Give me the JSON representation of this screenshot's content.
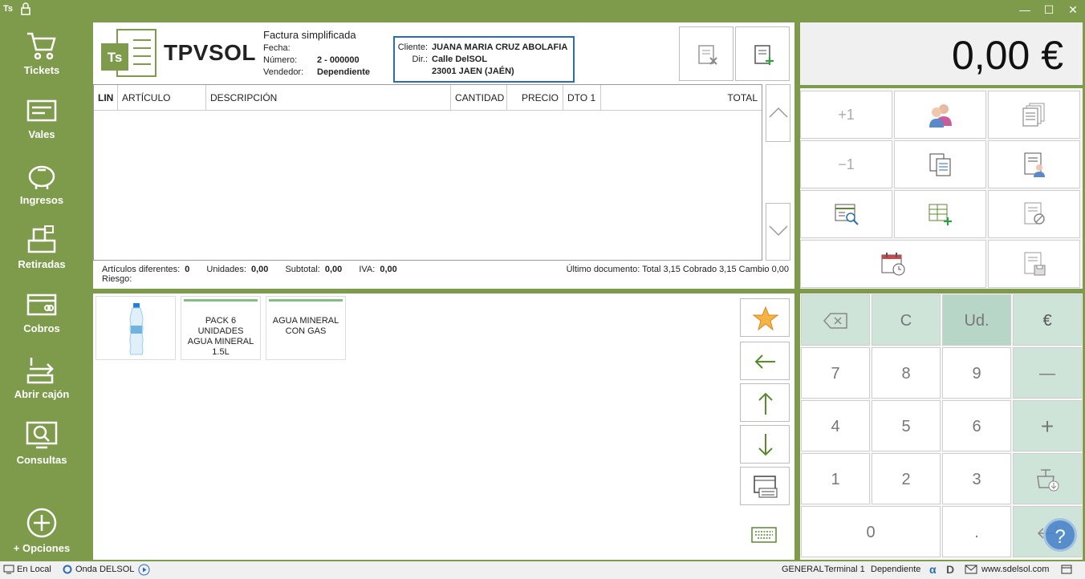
{
  "titlebar": {
    "app_short": "Ts",
    "minimize": "—",
    "maximize": "☐",
    "close": "✕"
  },
  "sidebar": {
    "items": [
      {
        "label": "Tickets"
      },
      {
        "label": "Vales"
      },
      {
        "label": "Ingresos"
      },
      {
        "label": "Retiradas"
      },
      {
        "label": "Cobros"
      },
      {
        "label": "Abrir cajón"
      },
      {
        "label": "Consultas"
      }
    ],
    "options_label": "+ Opciones"
  },
  "header": {
    "logo_mark": "Ts",
    "brand": "TPVSOL",
    "doc_type": "Factura simplificada",
    "fields": [
      {
        "key": "Fecha:",
        "value": ""
      },
      {
        "key": "Número:",
        "value": "2 - 000000"
      },
      {
        "key": "Vendedor:",
        "value": "Dependiente"
      }
    ],
    "client": {
      "client_label": "Cliente:",
      "client_name": "JUANA MARIA CRUZ ABOLAFIA",
      "dir_label": "Dir.:",
      "address1": "Calle DelSOL",
      "address2": "23001 JAEN (JAÉN)"
    }
  },
  "grid": {
    "columns": [
      "LIN",
      "ARTÍCULO",
      "DESCRIPCIÓN",
      "CANTIDAD",
      "PRECIO",
      "DTO 1",
      "TOTAL"
    ]
  },
  "summary": {
    "articulos_label": "Artículos diferentes:",
    "articulos": "0",
    "unidades_label": "Unidades:",
    "unidades": "0,00",
    "subtotal_label": "Subtotal:",
    "subtotal": "0,00",
    "iva_label": "IVA:",
    "iva": "0,00",
    "riesgo_label": "Riesgo:",
    "last_doc": "Último documento: Total 3,15 Cobrado 3,15 Cambio 0,00"
  },
  "products": [
    {
      "name": ""
    },
    {
      "name": "PACK 6 UNIDADES AGUA MINERAL 1.5L"
    },
    {
      "name": "AGUA MINERAL CON GAS"
    }
  ],
  "total": {
    "amount": "0,00 €"
  },
  "functions": {
    "plus_one": "+1",
    "minus_one": "−1"
  },
  "keypad": {
    "clear": "C",
    "units": "Ud.",
    "euro": "€",
    "k7": "7",
    "k8": "8",
    "k9": "9",
    "minus": "—",
    "k4": "4",
    "k5": "5",
    "k6": "6",
    "plus": "+",
    "k1": "1",
    "k2": "2",
    "k3": "3",
    "k0": "0",
    "dot": "."
  },
  "status": {
    "local": "En Local",
    "onda": "Onda DELSOL",
    "general": "GENERAL",
    "terminal": "Terminal 1",
    "user": "Dependiente",
    "web": "www.sdelsol.com"
  },
  "colors": {
    "sidebar": "#7d9b4b",
    "client_border": "#2a6db5",
    "keypad_green": "#cfe4d9"
  }
}
